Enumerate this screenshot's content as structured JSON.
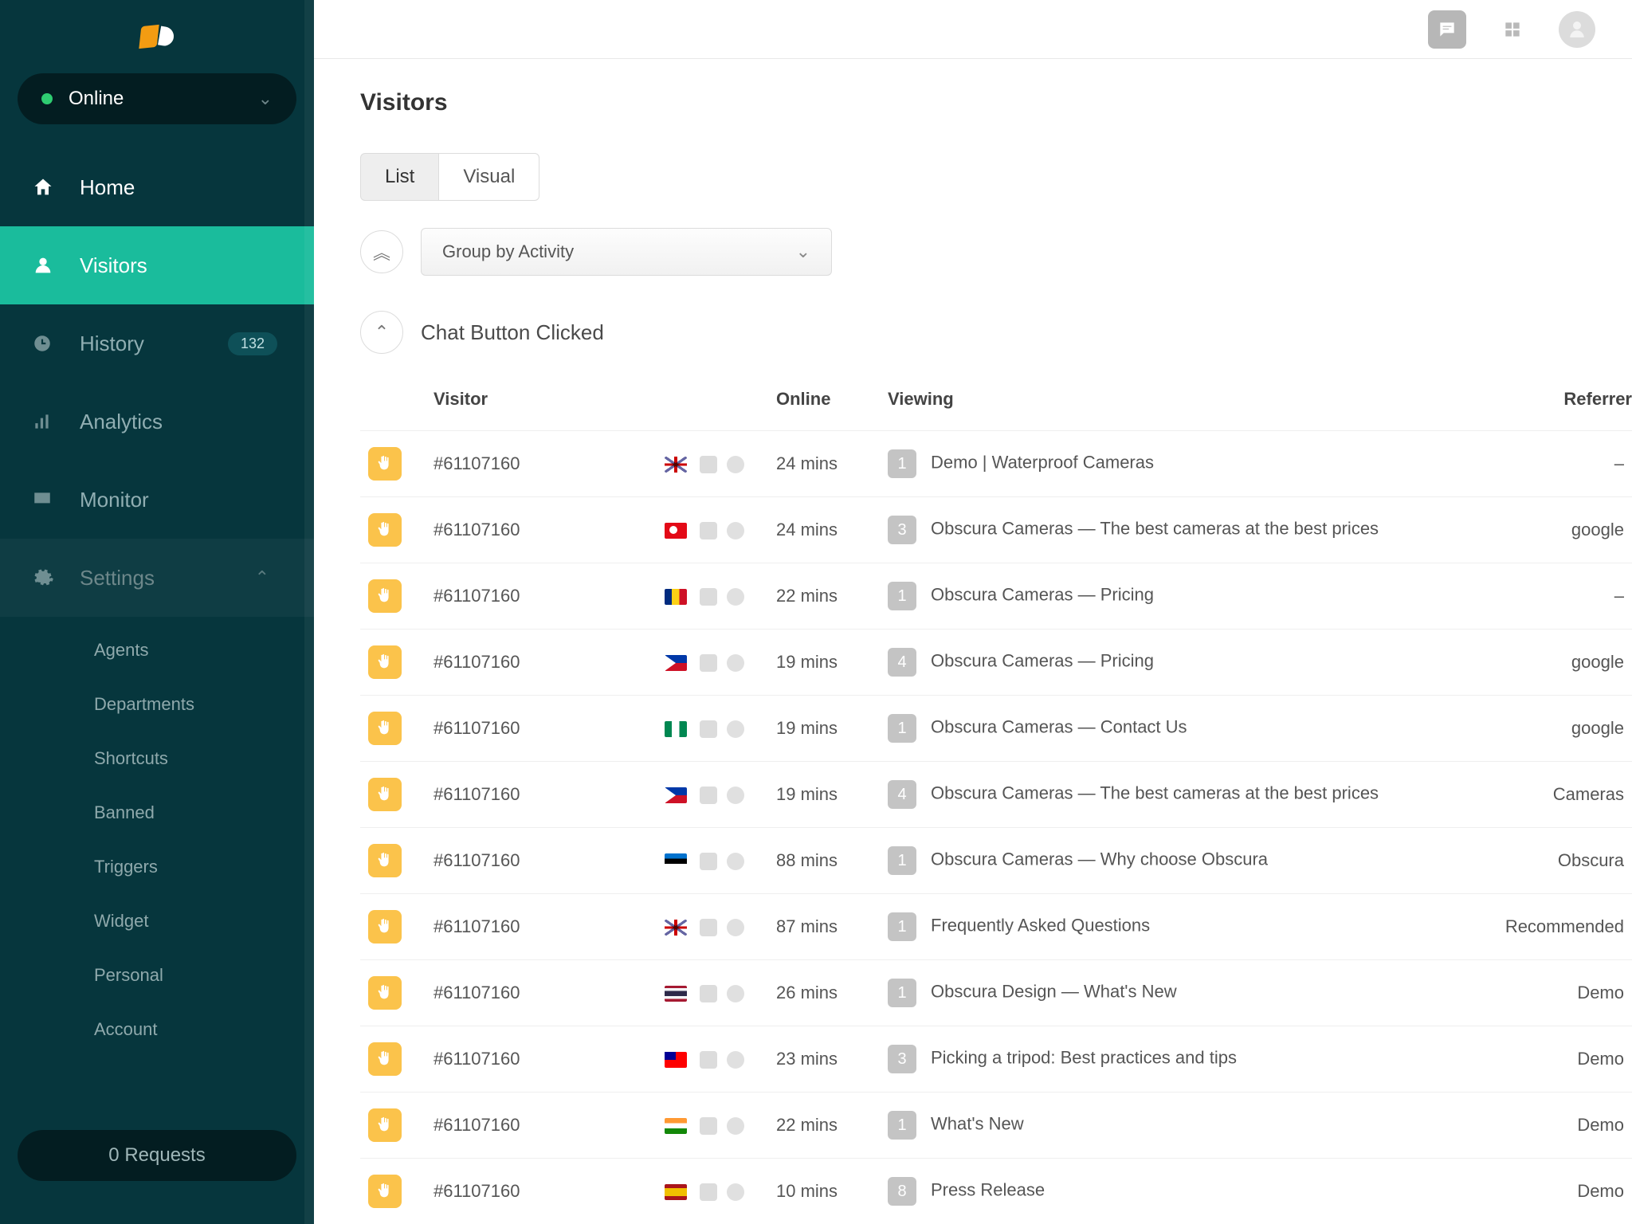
{
  "sidebar": {
    "status": {
      "label": "Online"
    },
    "nav": {
      "home": "Home",
      "visitors": "Visitors",
      "history": "History",
      "history_badge": "132",
      "analytics": "Analytics",
      "monitor": "Monitor",
      "settings": "Settings"
    },
    "settings_sub": [
      "Agents",
      "Departments",
      "Shortcuts",
      "Banned",
      "Triggers",
      "Widget",
      "Personal",
      "Account"
    ],
    "requests": "0 Requests"
  },
  "page": {
    "title": "Visitors",
    "tabs": {
      "list": "List",
      "visual": "Visual"
    },
    "group": "Group by Activity",
    "section": "Chat Button Clicked",
    "columns": {
      "visitor": "Visitor",
      "online": "Online",
      "viewing": "Viewing",
      "referrer": "Referrer"
    },
    "rows": [
      {
        "id": "#61107160",
        "flag": "gb",
        "online": "24 mins",
        "count": "1",
        "viewing": "Demo | Waterproof Cameras",
        "ref": "–"
      },
      {
        "id": "#61107160",
        "flag": "tr",
        "online": "24 mins",
        "count": "3",
        "viewing": "Obscura Cameras — The best cameras at the best prices",
        "ref": "google"
      },
      {
        "id": "#61107160",
        "flag": "ro",
        "online": "22 mins",
        "count": "1",
        "viewing": "Obscura Cameras — Pricing",
        "ref": "–"
      },
      {
        "id": "#61107160",
        "flag": "ph",
        "online": "19 mins",
        "count": "4",
        "viewing": "Obscura Cameras — Pricing",
        "ref": "google"
      },
      {
        "id": "#61107160",
        "flag": "ng",
        "online": "19 mins",
        "count": "1",
        "viewing": "Obscura Cameras — Contact Us",
        "ref": "google"
      },
      {
        "id": "#61107160",
        "flag": "ph",
        "online": "19 mins",
        "count": "4",
        "viewing": "Obscura Cameras — The best cameras at the best prices",
        "ref": "Cameras"
      },
      {
        "id": "#61107160",
        "flag": "ee",
        "online": "88 mins",
        "count": "1",
        "viewing": "Obscura Cameras — Why choose Obscura",
        "ref": "Obscura"
      },
      {
        "id": "#61107160",
        "flag": "gb",
        "online": "87 mins",
        "count": "1",
        "viewing": "Frequently Asked Questions",
        "ref": "Recommended"
      },
      {
        "id": "#61107160",
        "flag": "th",
        "online": "26 mins",
        "count": "1",
        "viewing": "Obscura Design — What's New",
        "ref": "Demo"
      },
      {
        "id": "#61107160",
        "flag": "tw",
        "online": "23 mins",
        "count": "3",
        "viewing": "Picking a tripod: Best practices and tips",
        "ref": "Demo"
      },
      {
        "id": "#61107160",
        "flag": "in",
        "online": "22 mins",
        "count": "1",
        "viewing": "What's New",
        "ref": "Demo"
      },
      {
        "id": "#61107160",
        "flag": "es",
        "online": "10 mins",
        "count": "8",
        "viewing": "Press Release",
        "ref": "Demo"
      }
    ]
  }
}
